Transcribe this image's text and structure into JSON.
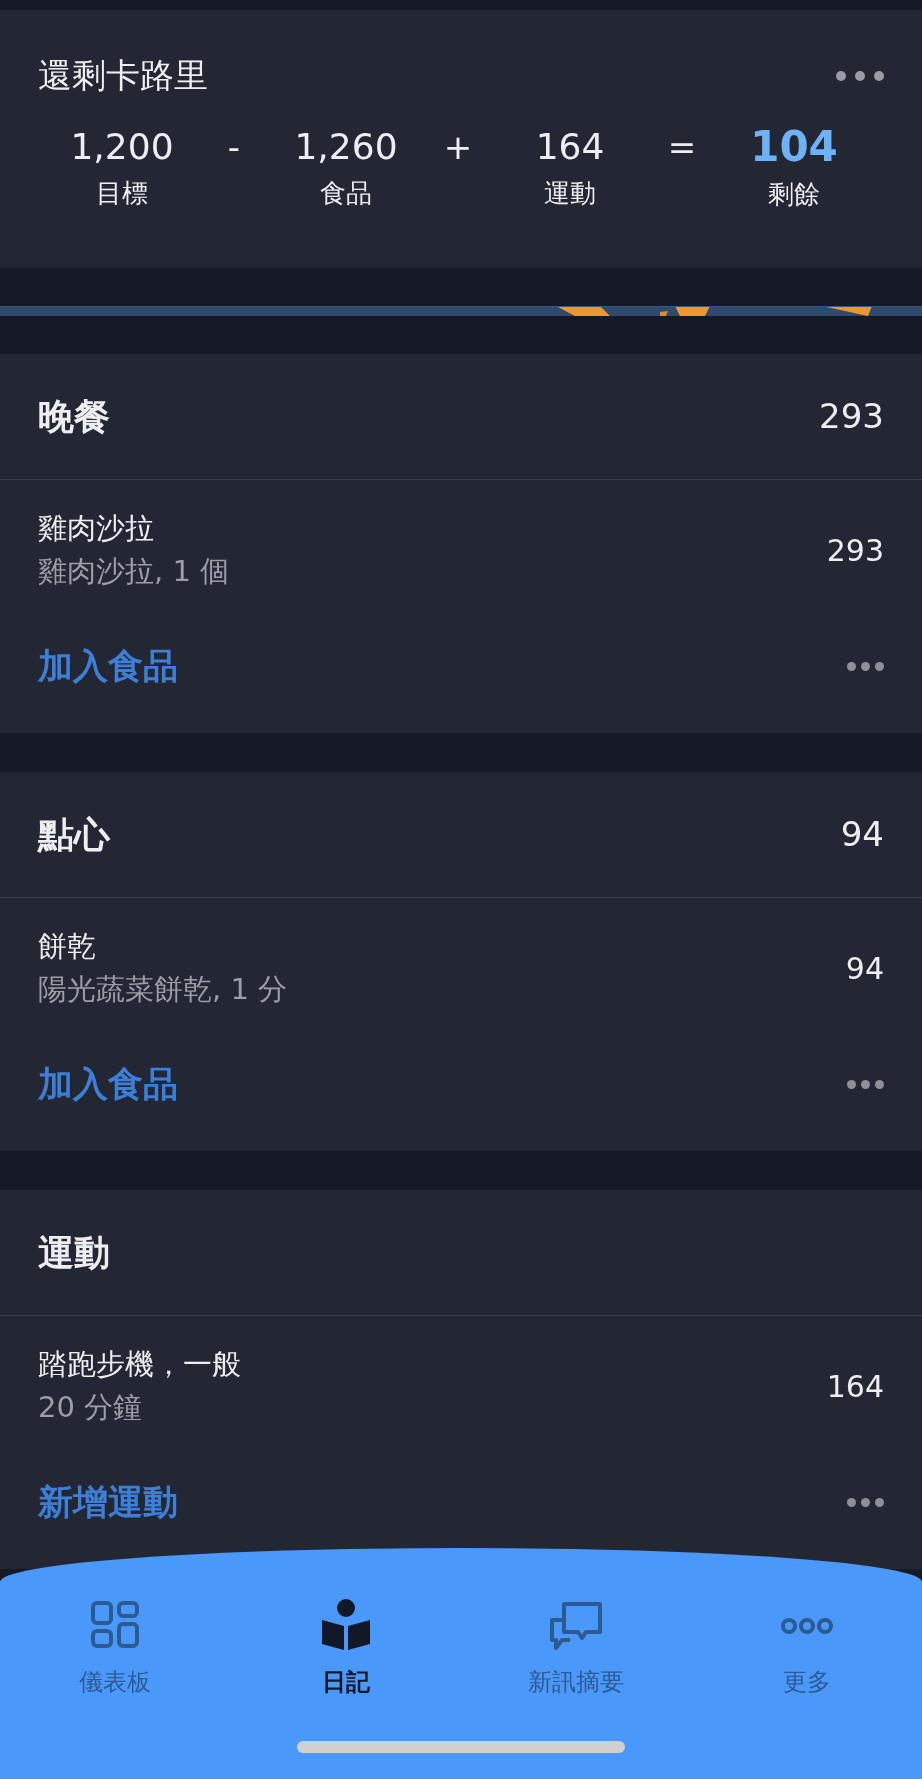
{
  "summary": {
    "title": "還剩卡路里",
    "terms": [
      {
        "value": "1,200",
        "label": "目標",
        "operator": "-",
        "highlight": false
      },
      {
        "value": "1,260",
        "label": "食品",
        "operator": "+",
        "highlight": false
      },
      {
        "value": "164",
        "label": "運動",
        "operator": "=",
        "highlight": false
      },
      {
        "value": "104",
        "label": "剩餘",
        "highlight": true
      }
    ]
  },
  "sections": [
    {
      "title": "晚餐",
      "total": "293",
      "items": [
        {
          "name": "雞肉沙拉",
          "detail": "雞肉沙拉, 1 個",
          "calories": "293"
        }
      ],
      "action": "加入食品"
    },
    {
      "title": "點心",
      "total": "94",
      "items": [
        {
          "name": "餅乾",
          "detail": "陽光蔬菜餅乾, 1 分",
          "calories": "94"
        }
      ],
      "action": "加入食品"
    },
    {
      "title": "運動",
      "items": [
        {
          "name": "踏跑步機，一般",
          "detail": "20 分鐘",
          "calories": "164"
        }
      ],
      "action": "新增運動"
    }
  ],
  "tabs": [
    {
      "label": "儀表板",
      "selected": false
    },
    {
      "label": "日記",
      "selected": true
    },
    {
      "label": "新訊摘要",
      "selected": false
    },
    {
      "label": "更多",
      "selected": false
    }
  ]
}
